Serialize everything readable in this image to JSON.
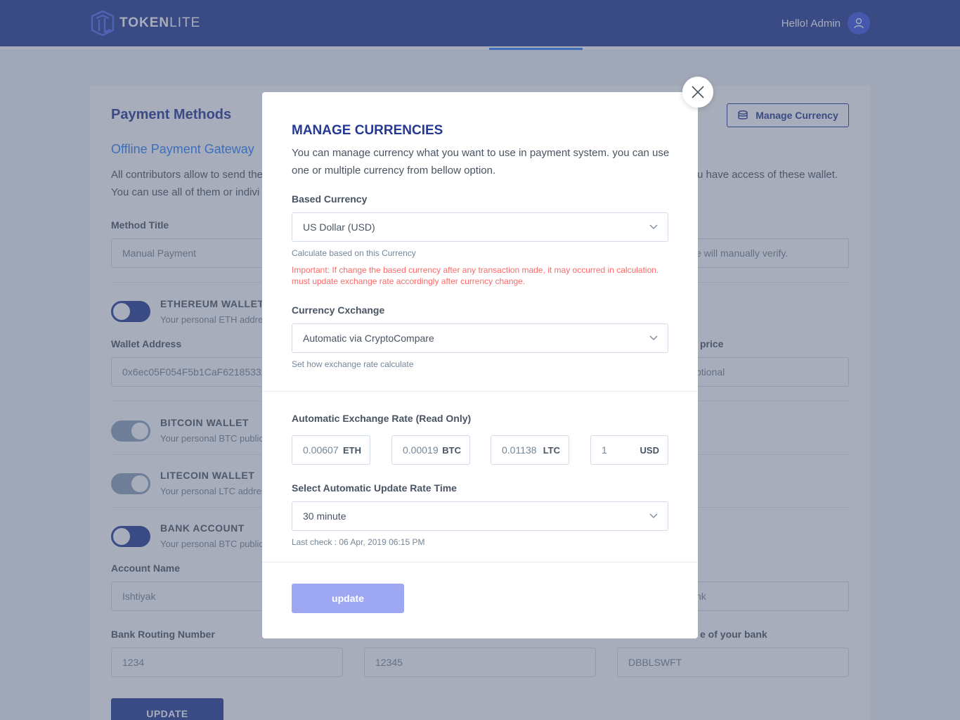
{
  "brand": {
    "name_bold": "TOKEN",
    "name_light": "LITE"
  },
  "user": {
    "greeting": "Hello! Admin"
  },
  "page": {
    "title": "Payment Methods",
    "manage_currency_label": "Manage Currency",
    "gateway_title": "Offline Payment Gateway",
    "gateway_desc_line1": "All contributors allow to send the",
    "gateway_desc_line2": "You can use all of them or indivi",
    "gateway_desc_right": "u have access of these wallet.",
    "method_title_label": "Method Title",
    "method_title_value": "Manual Payment",
    "method_title_right_value": "e will manually verify.",
    "wallets": [
      {
        "title": "ETHEREUM WALLET",
        "sub": "Your personal ETH addres"
      },
      {
        "title": "BITCOIN WALLET",
        "sub": "Your personal BTC public"
      },
      {
        "title": "LITECOIN WALLET",
        "sub": "Your personal LTC addres"
      },
      {
        "title": "BANK ACCOUNT",
        "sub": "Your personal BTC public"
      }
    ],
    "wallet_address_label": "Wallet Address",
    "wallet_address_value": "0x6ec05F054F5b1CaF621853320",
    "price_label": "price",
    "price_value": "ptional",
    "account_name_label": "Account Name",
    "account_name_value": "Ishtiyak",
    "bank_name_value": "nk",
    "routing_label": "Bank Routing Number",
    "routing_value": "1234",
    "middle_value": "12345",
    "swift_label": "e of your bank",
    "swift_value": "DBBLSWFT",
    "update_label": "UPDATE"
  },
  "modal": {
    "title": "MANAGE CURRENCIES",
    "description": "You can manage currency what you want to use in payment system. you can use one or multiple currency from bellow option.",
    "based_currency_label": "Based Currency",
    "based_currency_value": "US Dollar (USD)",
    "based_currency_hint": "Calculate based on this Currency",
    "warning": "Important: If change the based currency after any transaction made, it may occurred in calculation. must update exchange rate accordingly after currency change.",
    "exchange_label": "Currency Cxchange",
    "exchange_value": "Automatic via CryptoCompare",
    "exchange_hint": "Set how exchange rate calculate",
    "rate_label": "Automatic Exchange Rate (Read Only)",
    "rates": [
      {
        "value": "0.00607",
        "currency": "ETH"
      },
      {
        "value": "0.00019",
        "currency": "BTC"
      },
      {
        "value": "0.01138",
        "currency": "LTC"
      },
      {
        "value": "1",
        "currency": "USD"
      }
    ],
    "update_time_label": "Select Automatic Update Rate Time",
    "update_time_value": "30 minute",
    "last_check": "Last check : 06 Apr, 2019 06:15 PM",
    "update_button": "update"
  }
}
